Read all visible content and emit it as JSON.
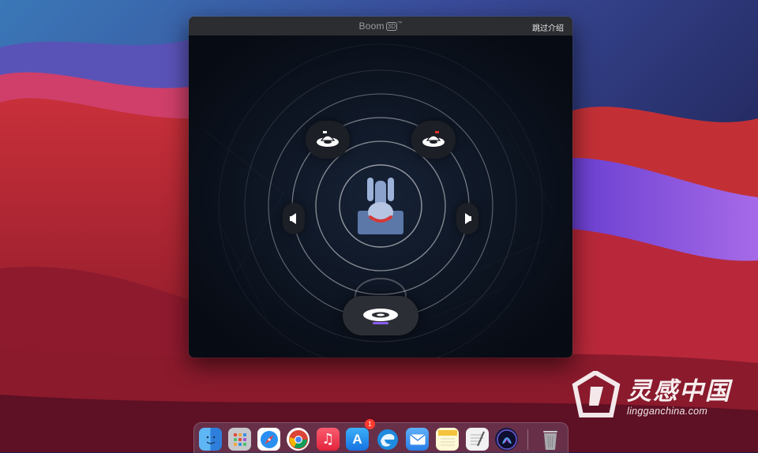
{
  "window": {
    "app_name": "Boom",
    "app_version_mark": "3D",
    "trademark": "™",
    "skip_label": "跳过介绍"
  },
  "speakers": [
    {
      "name": "front-left-speaker"
    },
    {
      "name": "front-right-speaker"
    },
    {
      "name": "side-left-speaker"
    },
    {
      "name": "side-right-speaker"
    },
    {
      "name": "subwoofer"
    }
  ],
  "dock": {
    "apps": [
      "Finder",
      "Launchpad",
      "Safari",
      "Chrome",
      "Music",
      "App Store",
      "Edge",
      "Mail",
      "Notes",
      "TextEdit",
      "Boom 3D",
      "Trash"
    ],
    "app_store_badge": "1"
  },
  "watermark": {
    "chinese": "灵感中国",
    "url": "lingganchina.com"
  },
  "colors": {
    "accent_red": "#e0322a",
    "accent_purple": "#8b5cf6",
    "window_bg": "#0b111b"
  }
}
